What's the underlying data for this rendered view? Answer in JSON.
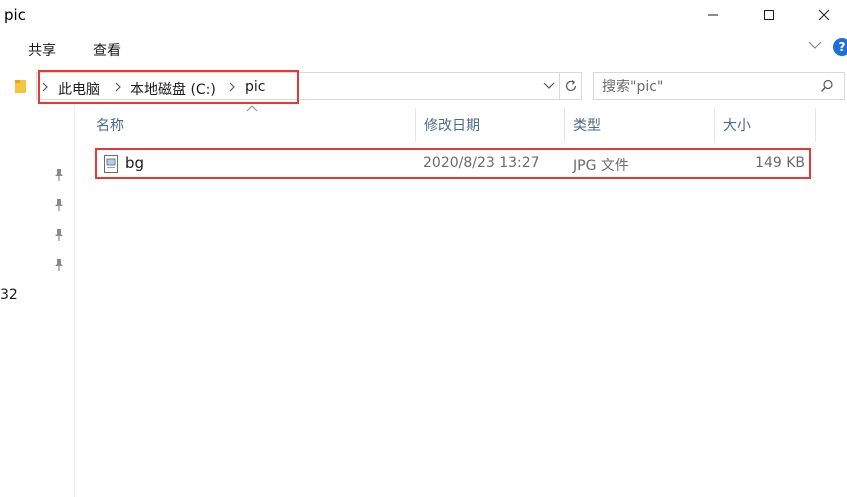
{
  "window": {
    "title": "pic"
  },
  "ribbon": {
    "tabs": [
      "共享",
      "查看"
    ]
  },
  "help": {
    "label": "?"
  },
  "address": {
    "crumbs": [
      "此电脑",
      "本地磁盘 (C:)",
      "pic"
    ]
  },
  "search": {
    "placeholder": "搜索\"pic\""
  },
  "nav": {
    "fragment": "32"
  },
  "columns": {
    "name": "名称",
    "date": "修改日期",
    "type": "类型",
    "size": "大小"
  },
  "files": [
    {
      "name": "bg",
      "date": "2020/8/23 13:27",
      "type": "JPG 文件",
      "size": "149 KB"
    }
  ],
  "colors": {
    "highlight": "#e53935",
    "header_text": "#4d6a85",
    "help_blue": "#1e6fd9"
  }
}
